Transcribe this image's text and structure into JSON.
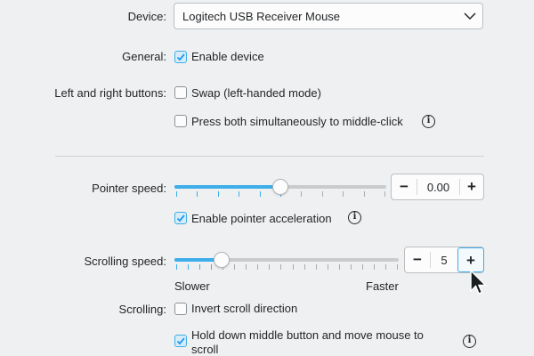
{
  "device": {
    "label": "Device:",
    "selected": "Logitech USB Receiver Mouse"
  },
  "general": {
    "label": "General:",
    "enable_device": {
      "text": "Enable device",
      "checked": true
    }
  },
  "buttons": {
    "label": "Left and right buttons:",
    "swap": {
      "text": "Swap (left-handed mode)",
      "checked": false
    },
    "middle_click": {
      "text": "Press both simultaneously to middle-click",
      "checked": false
    }
  },
  "pointer": {
    "label": "Pointer speed:",
    "value": "0.00",
    "fraction": 0.5,
    "acceleration": {
      "text": "Enable pointer acceleration",
      "checked": true
    }
  },
  "scrolling_speed": {
    "label": "Scrolling speed:",
    "value": "5",
    "level": 5,
    "min_label": "Slower",
    "max_label": "Faster"
  },
  "scrolling": {
    "label": "Scrolling:",
    "invert": {
      "text": "Invert scroll direction",
      "checked": false
    },
    "middle_scroll": {
      "text": "Hold down middle button and move mouse to",
      "text2": "scroll",
      "checked": true
    }
  },
  "symbols": {
    "minus": "−",
    "plus": "+",
    "info": "i"
  },
  "colors": {
    "accent": "#3daee9",
    "background": "#eff0f1",
    "text": "#232629"
  },
  "icons": [
    "chevron-down-icon",
    "checkmark-icon",
    "info-icon",
    "mouse-pointer-icon"
  ]
}
